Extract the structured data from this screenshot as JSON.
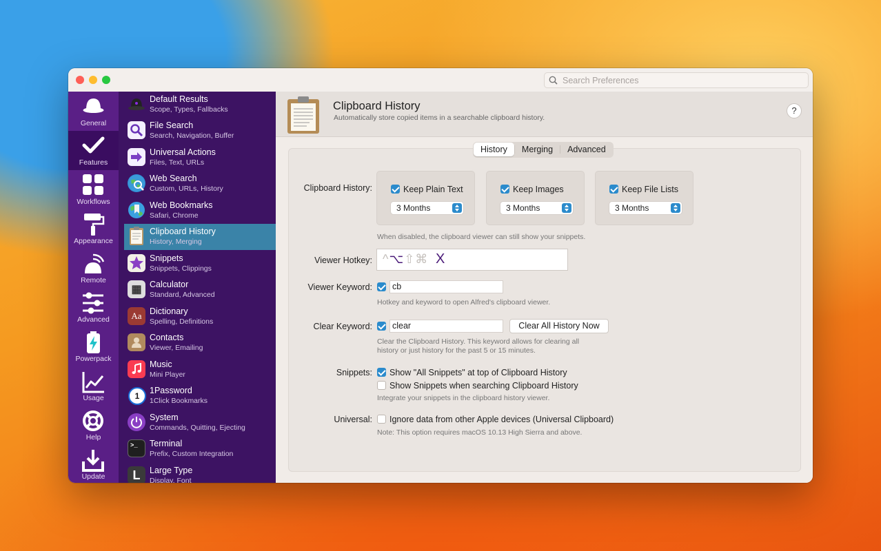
{
  "search": {
    "placeholder": "Search Preferences"
  },
  "rail": [
    {
      "label": "General",
      "icon": "hat-icon"
    },
    {
      "label": "Features",
      "icon": "checkmark-icon"
    },
    {
      "label": "Workflows",
      "icon": "grid-icon"
    },
    {
      "label": "Appearance",
      "icon": "paint-roller-icon"
    },
    {
      "label": "Remote",
      "icon": "remote-icon"
    },
    {
      "label": "Advanced",
      "icon": "sliders-icon"
    },
    {
      "label": "Powerpack",
      "icon": "battery-icon"
    },
    {
      "label": "Usage",
      "icon": "chart-icon"
    },
    {
      "label": "Help",
      "icon": "lifebuoy-icon"
    },
    {
      "label": "Update",
      "icon": "download-icon"
    }
  ],
  "features": [
    {
      "title": "Default Results",
      "sub": "Scope, Types, Fallbacks",
      "color": "#2a2a2a"
    },
    {
      "title": "File Search",
      "sub": "Search, Navigation, Buffer",
      "color": "#f4f0ff"
    },
    {
      "title": "Universal Actions",
      "sub": "Files, Text, URLs",
      "color": "#f4f0ff"
    },
    {
      "title": "Web Search",
      "sub": "Custom, URLs, History",
      "color": "#2f8fd8"
    },
    {
      "title": "Web Bookmarks",
      "sub": "Safari, Chrome",
      "color": "#3aa0e0"
    },
    {
      "title": "Clipboard History",
      "sub": "History, Merging",
      "color": "#d9c79e"
    },
    {
      "title": "Snippets",
      "sub": "Snippets, Clippings",
      "color": "#f2f0e6"
    },
    {
      "title": "Calculator",
      "sub": "Standard, Advanced",
      "color": "#dedede"
    },
    {
      "title": "Dictionary",
      "sub": "Spelling, Definitions",
      "color": "#9b3a33"
    },
    {
      "title": "Contacts",
      "sub": "Viewer, Emailing",
      "color": "#b08a5e"
    },
    {
      "title": "Music",
      "sub": "Mini Player",
      "color": "#fa3c52"
    },
    {
      "title": "1Password",
      "sub": "1Click Bookmarks",
      "color": "#ffffff"
    },
    {
      "title": "System",
      "sub": "Commands, Quitting, Ejecting",
      "color": "#8a3fc4"
    },
    {
      "title": "Terminal",
      "sub": "Prefix, Custom Integration",
      "color": "#1f1f1f"
    },
    {
      "title": "Large Type",
      "sub": "Display, Font",
      "color": "#3a3a3a"
    }
  ],
  "icon_glyphs": {
    "calculator": "▦",
    "dictionary": "Aa",
    "one_password": "1",
    "terminal": ">_",
    "large_type": "L"
  },
  "header": {
    "title": "Clipboard History",
    "subtitle": "Automatically store copied items in a searchable clipboard history.",
    "help": "?"
  },
  "tabs": [
    "History",
    "Merging",
    "Advanced"
  ],
  "history": {
    "label": "Clipboard History:",
    "cards": [
      {
        "label": "Keep Plain Text",
        "value": "3 Months",
        "checked": true
      },
      {
        "label": "Keep Images",
        "value": "3 Months",
        "checked": true
      },
      {
        "label": "Keep File Lists",
        "value": "3 Months",
        "checked": true
      }
    ],
    "note": "When disabled, the clipboard viewer can still show your snippets."
  },
  "hotkey": {
    "label": "Viewer Hotkey:",
    "mod_ctrl": "^",
    "mod_opt": "⌥",
    "mod_shift": "⇧",
    "mod_cmd": "⌘",
    "key": "X"
  },
  "viewer_keyword": {
    "label": "Viewer Keyword:",
    "value": "cb",
    "checked": true,
    "note": "Hotkey and keyword to open Alfred's clipboard viewer."
  },
  "clear_keyword": {
    "label": "Clear Keyword:",
    "value": "clear",
    "checked": true,
    "button": "Clear All History Now",
    "note1": "Clear the Clipboard History. This keyword allows for clearing all",
    "note2": "history or just history for the past 5 or 15 minutes."
  },
  "snippets": {
    "label": "Snippets:",
    "opt1": "Show \"All Snippets\" at top of Clipboard History",
    "opt2": "Show Snippets when searching Clipboard History",
    "note": "Integrate your snippets in the clipboard history viewer."
  },
  "universal": {
    "label": "Universal:",
    "opt": "Ignore data from other Apple devices (Universal Clipboard)",
    "note": "Note: This option requires macOS 10.13 High Sierra and above."
  },
  "colors": {
    "accent": "#2b8bcc",
    "sidebar": "#5a1f86",
    "list": "#3d1363",
    "selected": "#3a83a8"
  }
}
